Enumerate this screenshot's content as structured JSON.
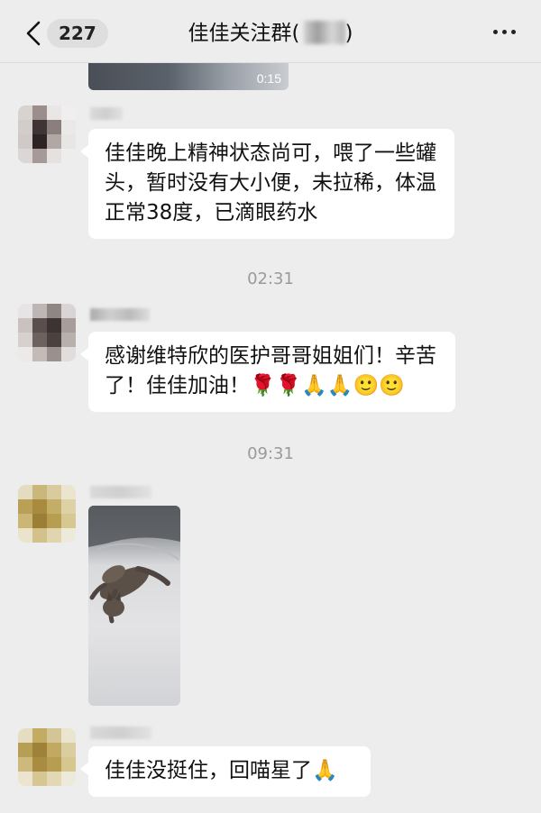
{
  "header": {
    "back_icon": "chevron-left-icon",
    "unread_count": "227",
    "title": "佳佳关注群(",
    "title_suffix": ")",
    "more_icon": "more-dots-icon"
  },
  "messages": [
    {
      "type": "video",
      "duration": "0:15"
    },
    {
      "type": "text",
      "text": "佳佳晚上精神状态尚可，喂了一些罐头，暂时没有大小便，未拉稀，体温正常38度，已滴眼药水"
    },
    {
      "type": "time",
      "text": "02:31"
    },
    {
      "type": "text",
      "text": "感谢维特欣的医护哥哥姐姐们！辛苦了！佳佳加油！🌹🌹🙏🙏🙂🙂"
    },
    {
      "type": "time",
      "text": "09:31"
    },
    {
      "type": "image",
      "subject": "cat-photo"
    },
    {
      "type": "text",
      "text": "佳佳没挺住，回喵星了🙏"
    }
  ],
  "colors": {
    "background": "#ededed",
    "bubble": "#ffffff",
    "timestamp": "#9a9a9a"
  }
}
